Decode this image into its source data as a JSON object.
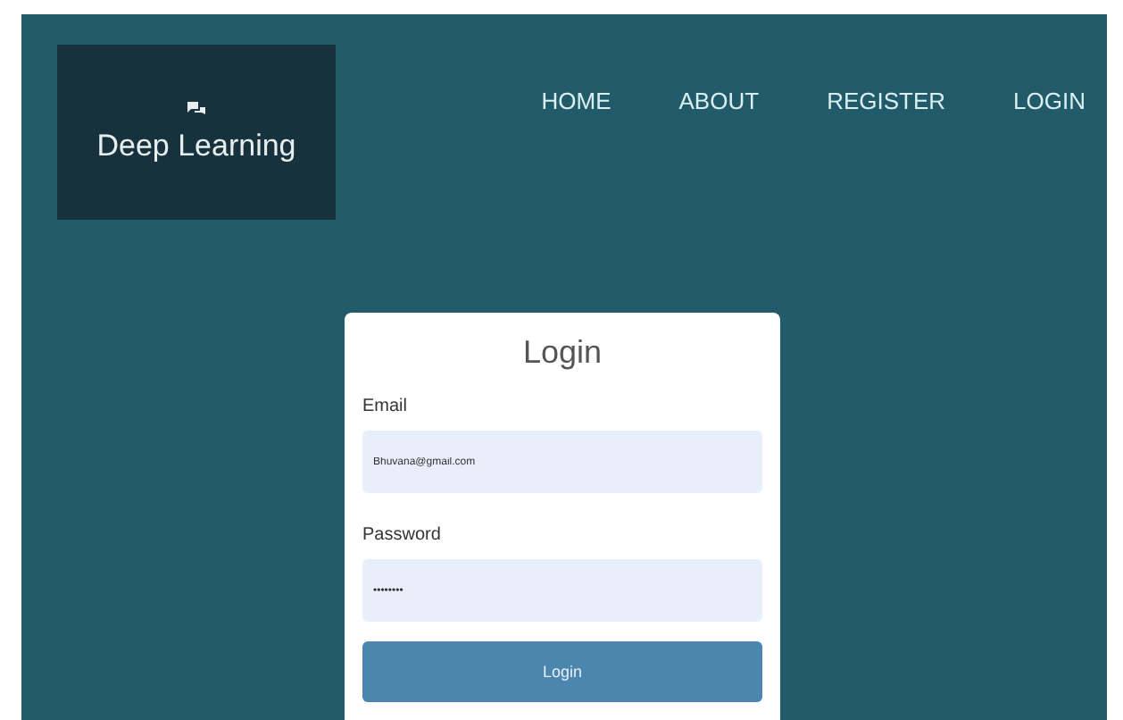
{
  "brand": {
    "title": "Deep Learning"
  },
  "nav": [
    {
      "label": "HOME"
    },
    {
      "label": "ABOUT"
    },
    {
      "label": "REGISTER"
    },
    {
      "label": "LOGIN"
    }
  ],
  "login_form": {
    "title": "Login",
    "fields": [
      {
        "label": "Email",
        "value": "Bhuvana@gmail.com"
      },
      {
        "label": "Password",
        "value": "••••••••"
      }
    ],
    "button": "Login"
  }
}
